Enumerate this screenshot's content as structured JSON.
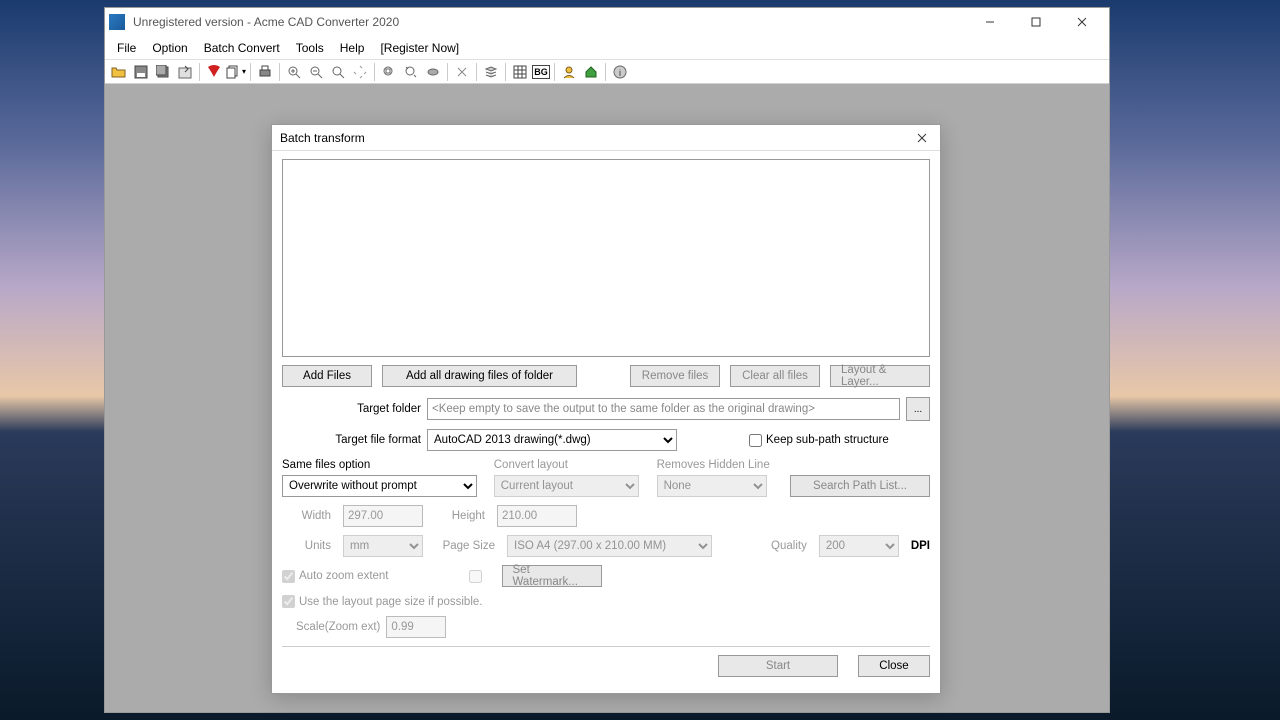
{
  "window": {
    "title": "Unregistered version - Acme CAD Converter 2020"
  },
  "menu": {
    "file": "File",
    "option": "Option",
    "batch": "Batch Convert",
    "tools": "Tools",
    "help": "Help",
    "register": "[Register Now]"
  },
  "dialog": {
    "title": "Batch transform",
    "add_files": "Add Files",
    "add_folder": "Add all drawing files of folder",
    "remove_files": "Remove files",
    "clear_all": "Clear all files",
    "layout_layer": "Layout & Layer...",
    "target_folder_label": "Target folder",
    "target_folder_placeholder": "<Keep empty to save the output to the same folder as the original drawing>",
    "browse": "...",
    "target_format_label": "Target file format",
    "target_format_value": "AutoCAD 2013 drawing(*.dwg)",
    "keep_subpath": "Keep sub-path structure",
    "same_files_label": "Same files option",
    "same_files_value": "Overwrite without prompt",
    "convert_layout_label": "Convert layout",
    "convert_layout_value": "Current layout",
    "removes_hidden_label": "Removes Hidden Line",
    "removes_hidden_value": "None",
    "search_path": "Search Path List...",
    "width_label": "Width",
    "width_value": "297.00",
    "height_label": "Height",
    "height_value": "210.00",
    "units_label": "Units",
    "units_value": "mm",
    "page_size_label": "Page Size",
    "page_size_value": "ISO A4 (297.00 x 210.00 MM)",
    "quality_label": "Quality",
    "quality_value": "200",
    "dpi": "DPI",
    "auto_zoom": "Auto zoom extent",
    "set_watermark": "Set Watermark...",
    "use_layout_page": "Use the layout page size if possible.",
    "scale_label": "Scale(Zoom ext)",
    "scale_value": "0.99",
    "start": "Start",
    "close": "Close"
  }
}
